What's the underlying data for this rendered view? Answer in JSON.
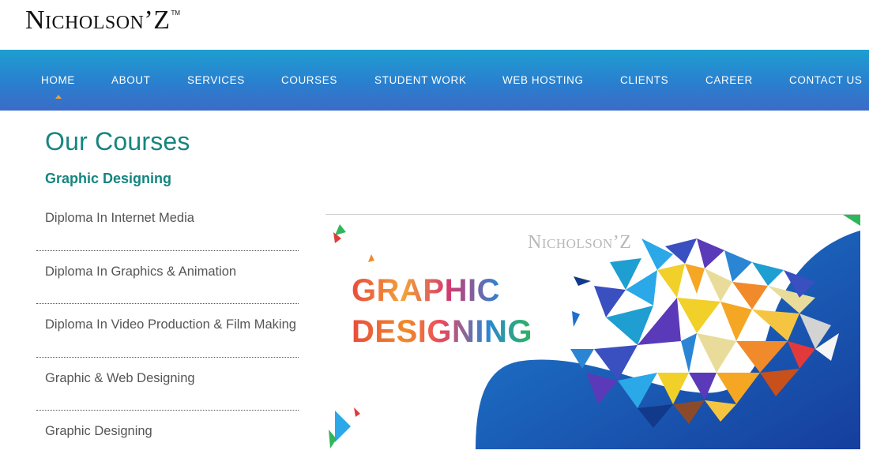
{
  "header": {
    "logo_text": "Nicholson’Z",
    "logo_tm": "TM"
  },
  "nav": {
    "items": [
      {
        "label": "HOME",
        "active": true
      },
      {
        "label": "ABOUT"
      },
      {
        "label": "SERVICES"
      },
      {
        "label": "COURSES"
      },
      {
        "label": "STUDENT WORK"
      },
      {
        "label": "WEB HOSTING"
      },
      {
        "label": "CLIENTS"
      },
      {
        "label": "CAREER"
      },
      {
        "label": "CONTACT US"
      }
    ],
    "active_marker_color": "#f0a22e"
  },
  "main": {
    "title": "Our Courses",
    "section_title": "Graphic Designing",
    "courses": [
      "Diploma In Internet Media",
      "Diploma In Graphics & Animation",
      "Diploma In Video Production & Film Making",
      "Graphic & Web Designing",
      "Graphic Designing"
    ]
  },
  "banner": {
    "brand": "Nicholson’Z",
    "line1": "GRAPHIC",
    "line2": "DESIGNING",
    "illustration": "lion-low-poly-illustration"
  },
  "colors": {
    "accent_teal": "#15857f",
    "nav_top": "#1e9ed1",
    "nav_bottom": "#3b6cc7",
    "banner_blue": "#1f5fb8"
  }
}
